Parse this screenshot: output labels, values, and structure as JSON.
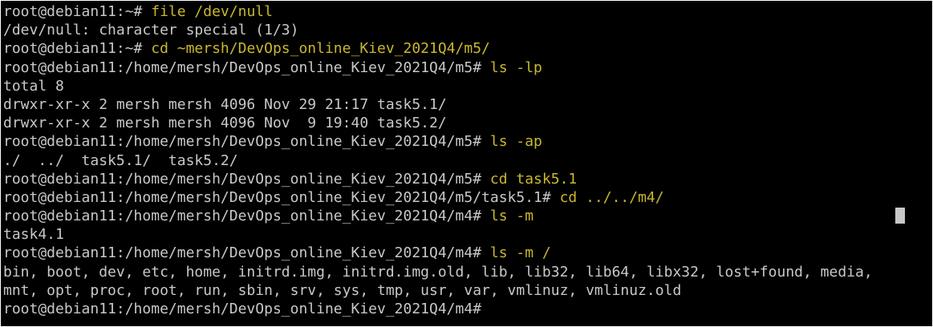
{
  "colors": {
    "background": "#000000",
    "text": "#c8c8c8",
    "command": "#c9b82e",
    "page_border": "#ffffff"
  },
  "lines": [
    {
      "prompt": "root@debian11:~# ",
      "cmd": "file /dev/null"
    },
    {
      "output": "/dev/null: character special (1/3)"
    },
    {
      "prompt": "root@debian11:~# ",
      "cmd": "cd ~mersh/DevOps_online_Kiev_2021Q4/m5/"
    },
    {
      "prompt": "root@debian11:/home/mersh/DevOps_online_Kiev_2021Q4/m5# ",
      "cmd": "ls -lp"
    },
    {
      "output": "total 8"
    },
    {
      "output": "drwxr-xr-x 2 mersh mersh 4096 Nov 29 21:17 task5.1/"
    },
    {
      "output": "drwxr-xr-x 2 mersh mersh 4096 Nov  9 19:40 task5.2/"
    },
    {
      "prompt": "root@debian11:/home/mersh/DevOps_online_Kiev_2021Q4/m5# ",
      "cmd": "ls -ap"
    },
    {
      "output": "./  ../  task5.1/  task5.2/"
    },
    {
      "prompt": "root@debian11:/home/mersh/DevOps_online_Kiev_2021Q4/m5# ",
      "cmd": "cd task5.1"
    },
    {
      "prompt": "root@debian11:/home/mersh/DevOps_online_Kiev_2021Q4/m5/task5.1# ",
      "cmd": "cd ../../m4/"
    },
    {
      "prompt": "root@debian11:/home/mersh/DevOps_online_Kiev_2021Q4/m4# ",
      "cmd": "ls -m"
    },
    {
      "output": "task4.1"
    },
    {
      "prompt": "root@debian11:/home/mersh/DevOps_online_Kiev_2021Q4/m4# ",
      "cmd": "ls -m /"
    },
    {
      "output": "bin, boot, dev, etc, home, initrd.img, initrd.img.old, lib, lib32, lib64, libx32, lost+found, media,"
    },
    {
      "output": "mnt, opt, proc, root, run, sbin, srv, sys, tmp, usr, var, vmlinuz, vmlinuz.old"
    },
    {
      "prompt": "root@debian11:/home/mersh/DevOps_online_Kiev_2021Q4/m4# ",
      "cmd": ""
    }
  ]
}
